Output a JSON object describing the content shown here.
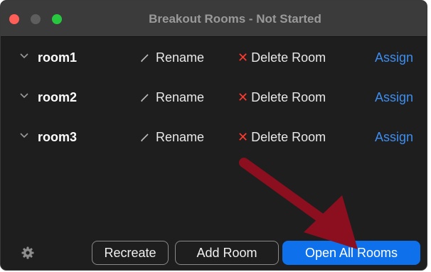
{
  "window": {
    "title": "Breakout Rooms - Not Started"
  },
  "rooms": [
    {
      "name": "room1",
      "rename_label": "Rename",
      "delete_label": "Delete Room",
      "assign_label": "Assign"
    },
    {
      "name": "room2",
      "rename_label": "Rename",
      "delete_label": "Delete Room",
      "assign_label": "Assign"
    },
    {
      "name": "room3",
      "rename_label": "Rename",
      "delete_label": "Delete Room",
      "assign_label": "Assign"
    }
  ],
  "footer": {
    "recreate_label": "Recreate",
    "add_room_label": "Add Room",
    "open_all_label": "Open All Rooms"
  },
  "icons": {
    "settings": "gear-icon",
    "rename": "pencil-icon",
    "delete": "x-icon",
    "expand": "chevron-down-icon"
  },
  "colors": {
    "primary_button": "#0e71eb",
    "link": "#3d8ef0",
    "delete": "#ff3b30",
    "annotation_arrow": "#8b0f1e"
  }
}
